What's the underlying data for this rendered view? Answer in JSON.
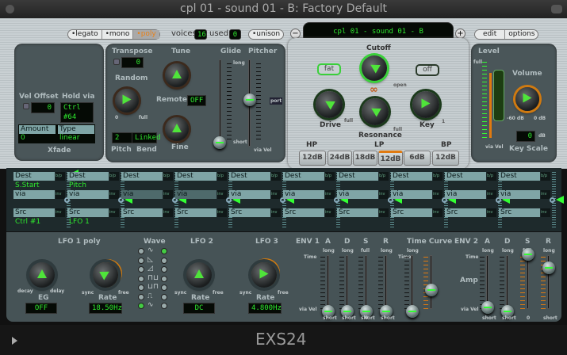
{
  "window": {
    "title": "cpl 01 - sound 01 - B: Factory Default"
  },
  "header": {
    "modes": [
      "•legato",
      "•mono",
      "•poly"
    ],
    "voices_label": "voices",
    "voices": "16",
    "used_label": "used",
    "used": "0",
    "unison": "•unison",
    "minus": "−",
    "plus": "+",
    "preset": "cpl 01 - sound 01 - B",
    "edit": "edit",
    "options": "options"
  },
  "xfade": {
    "vel_offset_label": "Vel Offset",
    "vel_offset": "0",
    "hold_via_label": "Hold via",
    "hold_via": "Ctrl #64",
    "amount_hdr": "Amount",
    "type_hdr": "Type",
    "amount": "0",
    "type": "linear",
    "label": "Xfade"
  },
  "pitch": {
    "transpose_label": "Transpose",
    "transpose": "0",
    "tune_label": "Tune",
    "random_label": "Random",
    "random_min": "0",
    "random_max": "full",
    "remote_label": "Remote",
    "remote": "OFF",
    "pitch_val": "2",
    "bend_val": "Linked",
    "pitch_label": "Pitch",
    "bend_label": "Bend",
    "fine_label": "Fine",
    "glide_label": "Glide",
    "pitcher_label": "Pitcher",
    "long": "long",
    "short": "short",
    "port": "port",
    "vel": "via Vel",
    "minus": "−",
    "plus": "+"
  },
  "filter": {
    "cutoff_label": "Cutoff",
    "fat": "fat",
    "off": "off",
    "drive_label": "Drive",
    "resonance_label": "Resonance",
    "key_label": "Key",
    "open": "open",
    "full": "full",
    "key_max": "1",
    "link_glyph": "∞",
    "hp": "HP",
    "lp": "LP",
    "bp": "BP",
    "slopes": [
      "12dB",
      "24dB",
      "18dB",
      "12dB",
      "6dB",
      "12dB"
    ],
    "active_slope": 3
  },
  "level": {
    "label": "Level",
    "full": "full",
    "vel": "via Vel",
    "volume_label": "Volume",
    "vol_min": "-60 dB",
    "vol_max": "0 dB",
    "key_scale": "0",
    "db": "dB",
    "key_scale_label": "Key Scale"
  },
  "mod_matrix": {
    "dest_label": "Dest",
    "via_label": "via",
    "src_label": "Src",
    "bp": "b/p",
    "inv": "inv",
    "slots": [
      {
        "dest": "S.Start",
        "via": "",
        "src": "Ctrl #1"
      },
      {
        "dest": "Pitch",
        "via": "",
        "src": "LFO 1"
      },
      {
        "dest": "",
        "via": "",
        "src": ""
      },
      {
        "dest": "",
        "via": "",
        "src": ""
      },
      {
        "dest": "",
        "via": "",
        "src": ""
      },
      {
        "dest": "",
        "via": "",
        "src": ""
      },
      {
        "dest": "",
        "via": "",
        "src": ""
      },
      {
        "dest": "",
        "via": "",
        "src": ""
      },
      {
        "dest": "",
        "via": "",
        "src": ""
      },
      {
        "dest": "",
        "via": "",
        "src": ""
      }
    ]
  },
  "lfo": {
    "lfo1_title": "LFO 1 poly",
    "eg_label": "EG",
    "decay": "decay",
    "delay": "delay",
    "eg_value": "OFF",
    "rate_label": "Rate",
    "sync": "sync",
    "free": "free",
    "lfo1_rate": "18.50Hz",
    "wave_label": "Wave",
    "waves": [
      "∿",
      "◺",
      "◿",
      "⊓⊔",
      "⊔⊓",
      "⎍",
      "∿"
    ],
    "lfo2_title": "LFO 2",
    "lfo2_rate": "DC",
    "lfo3_title": "LFO 3",
    "lfo3_rate": "4.800Hz"
  },
  "env": {
    "env1_title": "ENV 1",
    "env2_title": "ENV 2",
    "a": "A",
    "d": "D",
    "s": "S",
    "r": "R",
    "time_curve": "Time Curve",
    "time": "Time",
    "long": "long",
    "full": "full",
    "short": "short",
    "zero": "0",
    "vel": "via Vel",
    "amp": "Amp"
  },
  "footer": {
    "title": "EXS24"
  }
}
